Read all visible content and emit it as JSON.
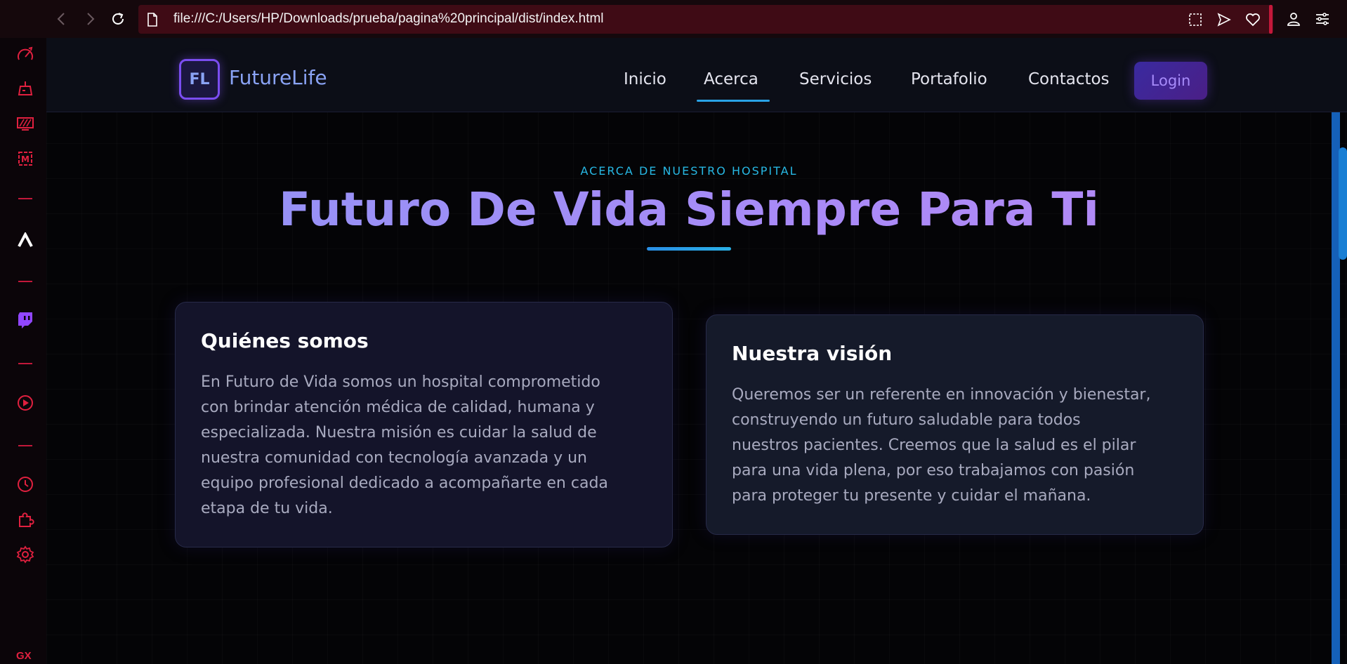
{
  "browser": {
    "url": "file:///C:/Users/HP/Downloads/prueba/pagina%20principal/dist/index.html",
    "sidebar": {
      "icons": [
        "speed-dial-icon",
        "cleaner-icon",
        "battery-limiter-icon",
        "m-app-icon",
        "inverted-v-app-icon",
        "twitch-icon",
        "player-icon",
        "history-icon",
        "extensions-icon",
        "settings-icon"
      ],
      "gx_label": "GX",
      "more_label": "..."
    },
    "colors": {
      "accent": "#e0203f",
      "urlbar": "#3f0b15"
    }
  },
  "site": {
    "logo_initials": "FL",
    "logo_name": "FutureLife",
    "nav": [
      "Inicio",
      "Acerca",
      "Servicios",
      "Portafolio",
      "Contactos"
    ],
    "active_nav": "Acerca",
    "login_label": "Login"
  },
  "section": {
    "eyebrow": "ACERCA DE NUESTRO HOSPITAL",
    "title": "Futuro De Vida Siempre Para Ti"
  },
  "cards": [
    {
      "title": "Quiénes somos",
      "lines": [
        "En Futuro de Vida somos un hospital comprometido",
        "con brindar atención médica de calidad, humana y",
        "especializada. Nuestra misión es cuidar la salud de",
        "nuestra comunidad con tecnología avanzada y un",
        "equipo profesional dedicado a acompañarte en cada",
        "etapa de tu vida."
      ]
    },
    {
      "title": "Nuestra visión",
      "lines": [
        "Queremos ser un referente en innovación y bienestar,",
        "construyendo un futuro saludable para todos",
        "nuestros pacientes. Creemos que la salud es el pilar",
        "para una vida plena, por eso trabajamos con pasión",
        "para proteger tu presente y cuidar el mañana."
      ]
    }
  ]
}
